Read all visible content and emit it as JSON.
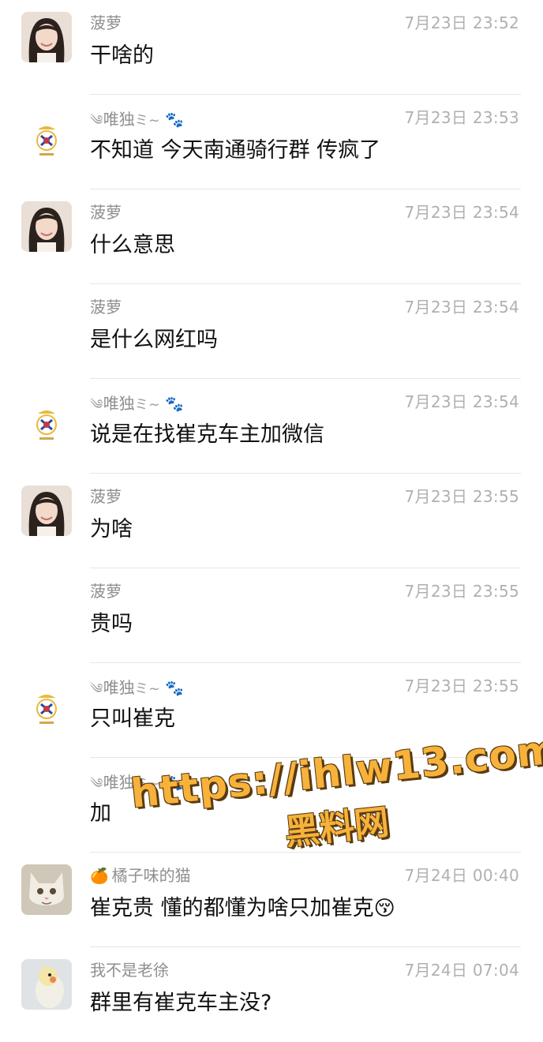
{
  "messages": [
    {
      "sender": "菠萝",
      "time": "7月23日 23:52",
      "text": "干啥的",
      "avatar": "girl-photo"
    },
    {
      "sender": "唯独",
      "time": "7月23日 23:53",
      "text": "不知道  今天南通骑行群 传疯了",
      "avatar": "crest-badge"
    },
    {
      "sender": "菠萝",
      "time": "7月23日 23:54",
      "text": "什么意思",
      "avatar": "girl-photo"
    },
    {
      "sender": "菠萝",
      "time": "7月23日 23:54",
      "text": "是什么网红吗",
      "avatar": "none"
    },
    {
      "sender": "唯独",
      "time": "7月23日 23:54",
      "text": "说是在找崔克车主加微信",
      "avatar": "crest-badge"
    },
    {
      "sender": "菠萝",
      "time": "7月23日 23:55",
      "text": "为啥",
      "avatar": "girl-photo"
    },
    {
      "sender": "菠萝",
      "time": "7月23日 23:55",
      "text": "贵吗",
      "avatar": "none"
    },
    {
      "sender": "唯独",
      "time": "7月23日 23:55",
      "text": "只叫崔克",
      "avatar": "crest-badge"
    },
    {
      "sender": "唯独",
      "time": "",
      "text": "加",
      "avatar": "none"
    },
    {
      "sender": "橘子味的猫",
      "time": "7月24日 00:40",
      "text": "崔克贵 懂的都懂为啥只加崔克",
      "avatar": "cat-photo",
      "sender_emoji": "🍊",
      "text_emoji": "😚"
    },
    {
      "sender": "我不是老徐",
      "time": "7月24日 07:04",
      "text": "群里有崔克车主没?",
      "avatar": "bird-photo"
    }
  ],
  "watermark": {
    "url": "https://ihlw13.com",
    "name": "黑料网"
  },
  "colors": {
    "name": "#8f8f8f",
    "time": "#b0b0b0",
    "text": "#111111",
    "divider": "#e6e6e6",
    "watermark": "#f7b23b"
  }
}
